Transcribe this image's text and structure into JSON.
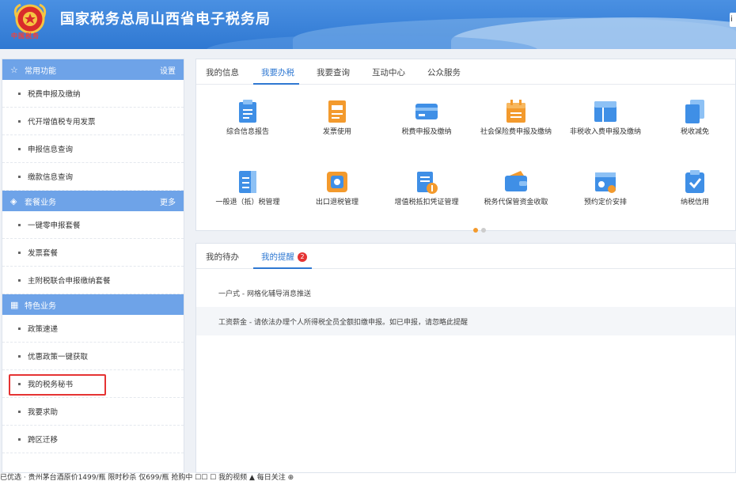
{
  "header": {
    "title": "国家税务总局山西省电子税务局",
    "logo_script": "中国税务",
    "edge_text": "i"
  },
  "sidebar": {
    "sections": [
      {
        "title": "常用功能",
        "action": "设置",
        "icon": "star-icon",
        "items": [
          "税费申报及缴纳",
          "代开增值税专用发票",
          "申报信息查询",
          "缴款信息查询"
        ]
      },
      {
        "title": "套餐业务",
        "action": "更多",
        "icon": "package-icon",
        "items": [
          "一键零申报套餐",
          "发票套餐",
          "主附税联合申报缴纳套餐"
        ]
      },
      {
        "title": "特色业务",
        "action": "",
        "icon": "grid-icon",
        "items": [
          "政策速递",
          "优惠政策一键获取",
          "我的税务秘书",
          "我要求助",
          "跨区迁移"
        ]
      }
    ],
    "highlighted_item": "我的税务秘书"
  },
  "top_tabs": [
    "我的信息",
    "我要办税",
    "我要查询",
    "互动中心",
    "公众服务"
  ],
  "active_top_tab": "我要办税",
  "services": [
    {
      "label": "综合信息报告",
      "icon": "report-icon"
    },
    {
      "label": "发票使用",
      "icon": "invoice-icon"
    },
    {
      "label": "税费申报及缴纳",
      "icon": "card-icon"
    },
    {
      "label": "社会保险费申报及缴纳",
      "icon": "calendar-icon"
    },
    {
      "label": "非税收入费申报及缴纳",
      "icon": "layout-icon"
    },
    {
      "label": "税收减免",
      "icon": "copy-icon"
    },
    {
      "label": "一般退（抵）税管理",
      "icon": "list-icon"
    },
    {
      "label": "出口退税管理",
      "icon": "export-icon"
    },
    {
      "label": "增值税抵扣凭证管理",
      "icon": "voucher-icon"
    },
    {
      "label": "税务代保管资金收取",
      "icon": "wallet-icon"
    },
    {
      "label": "预约定价安排",
      "icon": "appointment-icon"
    },
    {
      "label": "纳税信用",
      "icon": "credit-icon"
    }
  ],
  "carousel": {
    "pages": 2,
    "current": 1
  },
  "bottom_tabs": [
    "我的待办",
    "我的提醒"
  ],
  "active_bottom_tab": "我的提醒",
  "reminder_badge": "2",
  "messages": [
    "一户式 - 网格化辅导消息推送",
    "工资薪金 - 请依法办理个人所得税全员全额扣缴申报。如已申报，请忽略此提醒"
  ],
  "statusbar": "已优选  ·  贵州茅台酒原价1499/瓶 限时秒杀 仅699/瓶 抢购中 ☐☐             ☐ 我的视频    ▲ 每日关注    ⊕"
}
